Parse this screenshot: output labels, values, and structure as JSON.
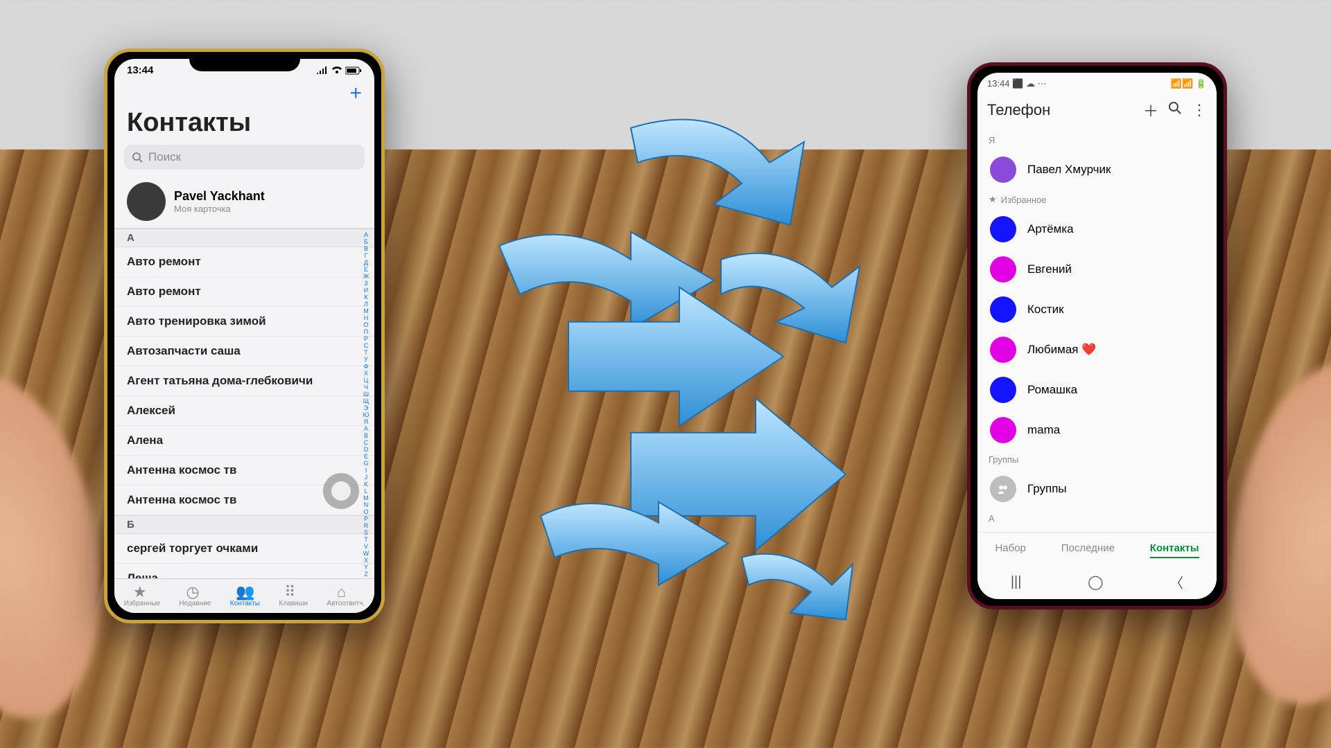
{
  "iphone": {
    "status_time": "13:44",
    "plus": "+",
    "title": "Контакты",
    "search_placeholder": "Поиск",
    "me": {
      "name": "Pavel Yackhant",
      "sub": "Моя карточка"
    },
    "sections": [
      {
        "letter": "А",
        "items": [
          "Авто ремонт",
          "Авто ремонт",
          "Авто тренировка зимой",
          "Автозапчасти саша",
          "Агент татьяна дома-глебковичи",
          "Алексей",
          "Алена",
          "Антенна космос тв",
          "Антенна космос тв"
        ]
      },
      {
        "letter": "Б",
        "items": [
          "сергей торгует очками"
        ]
      },
      {
        "letter": "",
        "items": [
          "Леша"
        ]
      }
    ],
    "index_letters": [
      "А",
      "Б",
      "В",
      "Г",
      "Д",
      "Е",
      "Ж",
      "З",
      "И",
      "К",
      "Л",
      "М",
      "Н",
      "О",
      "П",
      "Р",
      "С",
      "Т",
      "У",
      "Ф",
      "Х",
      "Ц",
      "Ч",
      "Ш",
      "Щ",
      "Э",
      "Ю",
      "Я",
      "A",
      "B",
      "C",
      "D",
      "E",
      "G",
      "I",
      "J",
      "K",
      "L",
      "M",
      "N",
      "O",
      "P",
      "R",
      "S",
      "T",
      "V",
      "W",
      "X",
      "Y",
      "Z",
      "#"
    ],
    "tabs": [
      {
        "label": "Избранные",
        "icon": "star"
      },
      {
        "label": "Недавние",
        "icon": "clock"
      },
      {
        "label": "Контакты",
        "icon": "person",
        "active": true
      },
      {
        "label": "Клавиши",
        "icon": "keypad"
      },
      {
        "label": "Автоответч.",
        "icon": "voicemail"
      }
    ]
  },
  "samsung": {
    "status_time": "13:44",
    "title": "Телефон",
    "me_section": "Я",
    "me_name": "Павел Хмурчик",
    "fav_section": "Избранное",
    "favorites": [
      {
        "name": "Артёмка",
        "color": "c-blue"
      },
      {
        "name": "Евгений",
        "color": "c-mag"
      },
      {
        "name": "Костик",
        "color": "c-blue"
      },
      {
        "name": "Любимая ❤️",
        "color": "c-mag"
      },
      {
        "name": "Ромашка",
        "color": "c-blue"
      },
      {
        "name": "mama",
        "color": "c-mag"
      }
    ],
    "groups_section": "Группы",
    "groups_label": "Группы",
    "letter_section": "А",
    "tabs": [
      "Набор",
      "Последние",
      "Контакты"
    ],
    "active_tab": 2
  }
}
